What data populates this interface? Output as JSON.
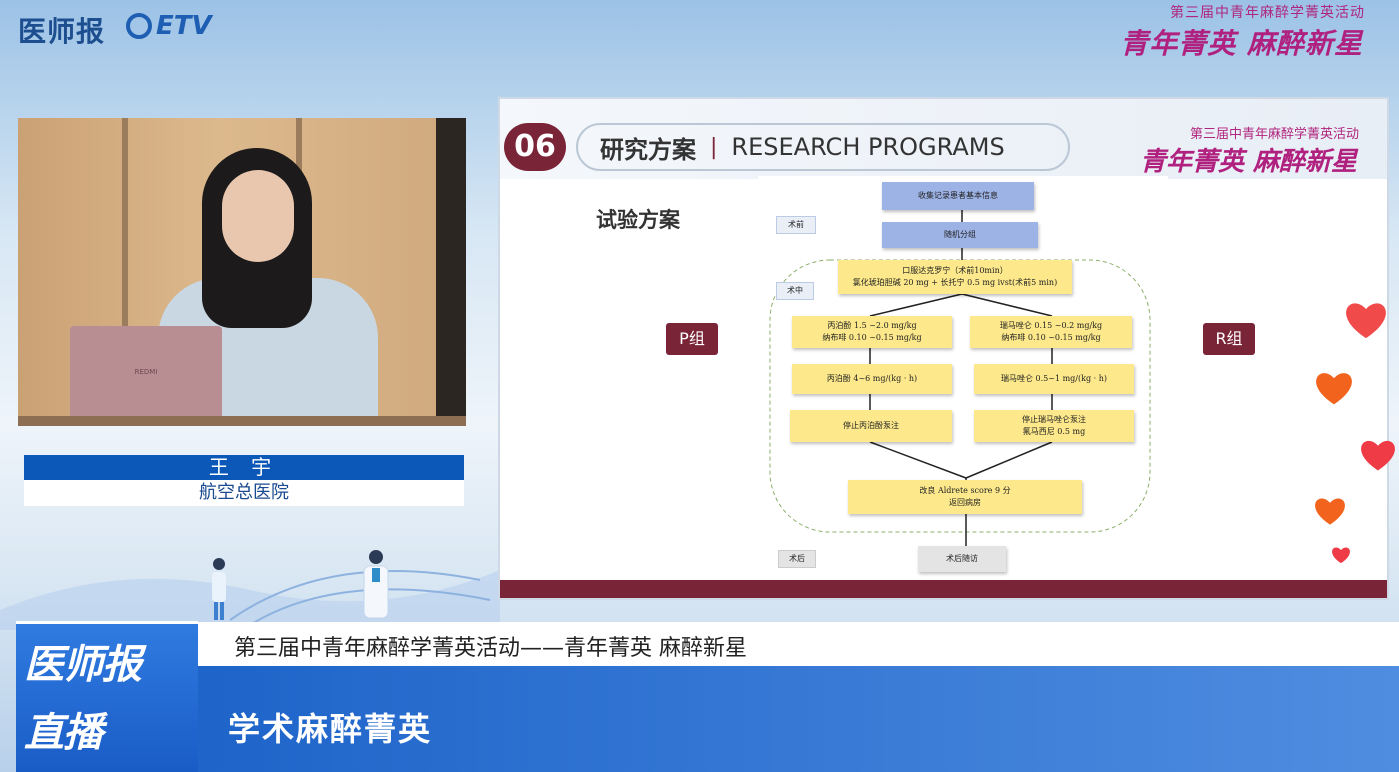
{
  "header": {
    "logo_left": "医师报",
    "logo_etv": "ETV",
    "event_subtitle": "第三届中青年麻醉学菁英活动",
    "event_title": "青年菁英 麻醉新星"
  },
  "video": {
    "laptop_brand": "REDMI"
  },
  "speaker": {
    "name": "王 宇",
    "organization": "航空总医院"
  },
  "slide": {
    "number": "06",
    "title_cn": "研究方案",
    "title_sep": "|",
    "title_en": "RESEARCH PROGRAMS",
    "event_subtitle": "第三届中青年麻醉学菁英活动",
    "event_title": "青年菁英 麻醉新星",
    "heading": "试验方案",
    "group_p": "P组",
    "group_r": "R组",
    "flowchart": {
      "tag_pre": "术前",
      "tag_intra": "术中",
      "tag_post": "术后",
      "step_collect": "收集记录患者基本信息",
      "step_random": "随机分组",
      "step_premed_1": "口服达克罗宁（术前10min）",
      "step_premed_2": "氯化琥珀胆碱 20 mg + 长托宁 0.5 mg ivst(术前5 min)",
      "p_induction_1": "丙泊酚 1.5 ~2.0 mg/kg",
      "p_induction_2": "纳布啡 0.10 ~0.15 mg/kg",
      "r_induction_1": "瑞马唑仑 0.15 ~0.2 mg/kg",
      "r_induction_2": "纳布啡 0.10 ~0.15 mg/kg",
      "p_maintain": "丙泊酚 4~6 mg/(kg · h)",
      "r_maintain": "瑞马唑仑 0.5~1 mg/(kg · h)",
      "p_stop": "停止丙泊酚泵注",
      "r_stop_1": "停止瑞马唑仑泵注",
      "r_stop_2": "氟马西尼 0.5 mg",
      "recover_1": "改良 Aldrete score 9 分",
      "recover_2": "返回病房",
      "followup": "术后随访"
    }
  },
  "lower_third": {
    "channel_line1": "医师报",
    "channel_line2": "直播",
    "ticker": "第三届中青年麻醉学菁英活动——青年菁英  麻醉新星",
    "subtitle": "学术麻醉菁英"
  },
  "colors": {
    "brand_blue": "#0c58b8",
    "slide_accent": "#7a2437",
    "event_magenta": "#b0207e",
    "flow_box_yellow": "#fde98b",
    "flow_box_blue": "#9db3e6"
  },
  "icons": [
    "heart-icon",
    "heart-icon",
    "heart-icon",
    "heart-icon",
    "heart-icon",
    "doctor-figure-icon"
  ]
}
